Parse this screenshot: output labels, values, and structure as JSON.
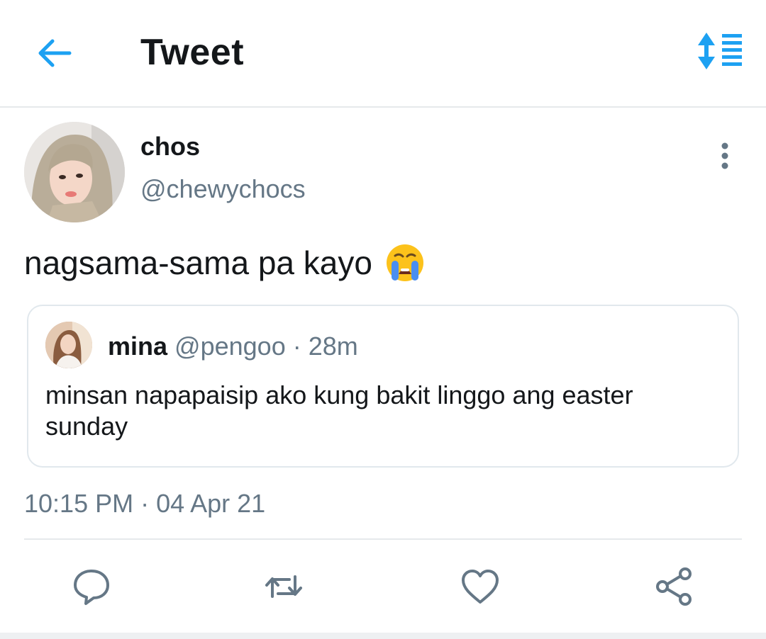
{
  "header": {
    "title": "Tweet",
    "back_icon": "arrow-left-icon",
    "sort_icon": "sort-lines-icon",
    "accent_color": "#1da1f2"
  },
  "tweet": {
    "display_name": "chos",
    "handle": "@chewychocs",
    "text": "nagsama-sama pa kayo",
    "emoji_icon": "loudly-crying-face-emoji",
    "timestamp": "10:15 PM · 04 Apr 21",
    "more_icon": "vertical-dots-icon"
  },
  "quoted_tweet": {
    "display_name": "mina",
    "meta": "@pengoo · 28m",
    "text": "minsan napapaisip ako kung bakit linggo ang easter sunday"
  },
  "actions": [
    {
      "icon": "reply-icon"
    },
    {
      "icon": "retweet-icon"
    },
    {
      "icon": "like-heart-icon"
    },
    {
      "icon": "share-icon"
    }
  ]
}
